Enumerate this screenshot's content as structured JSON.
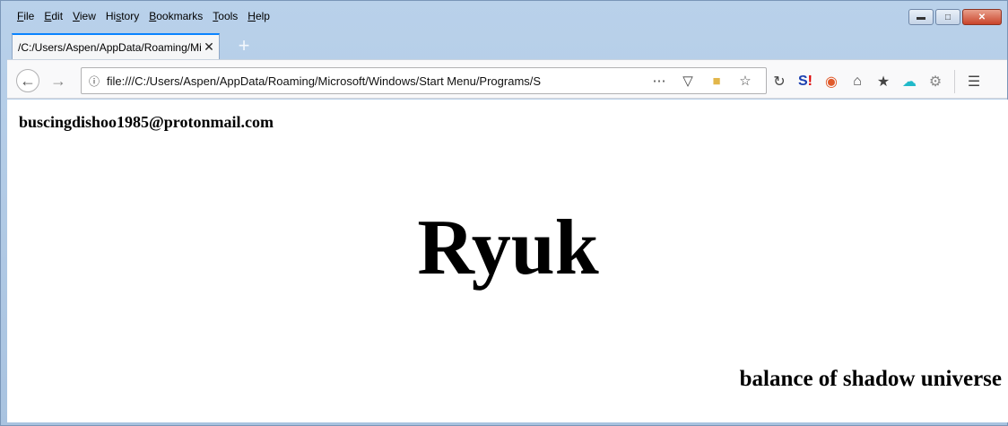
{
  "menu": [
    "File",
    "Edit",
    "View",
    "History",
    "Bookmarks",
    "Tools",
    "Help"
  ],
  "menu_underline": [
    "F",
    "E",
    "V",
    "s",
    "B",
    "T",
    "H"
  ],
  "tab": {
    "title": "/C:/Users/Aspen/AppData/Roaming/Microsoft/Windows/Start Menu/Programs/S"
  },
  "address": {
    "url": "file:///C:/Users/Aspen/AppData/Roaming/Microsoft/Windows/Start Menu/Programs/S"
  },
  "page": {
    "email": "buscingdishoo1985@protonmail.com",
    "headline": "Ryuk",
    "tagline": "balance of shadow universe"
  }
}
